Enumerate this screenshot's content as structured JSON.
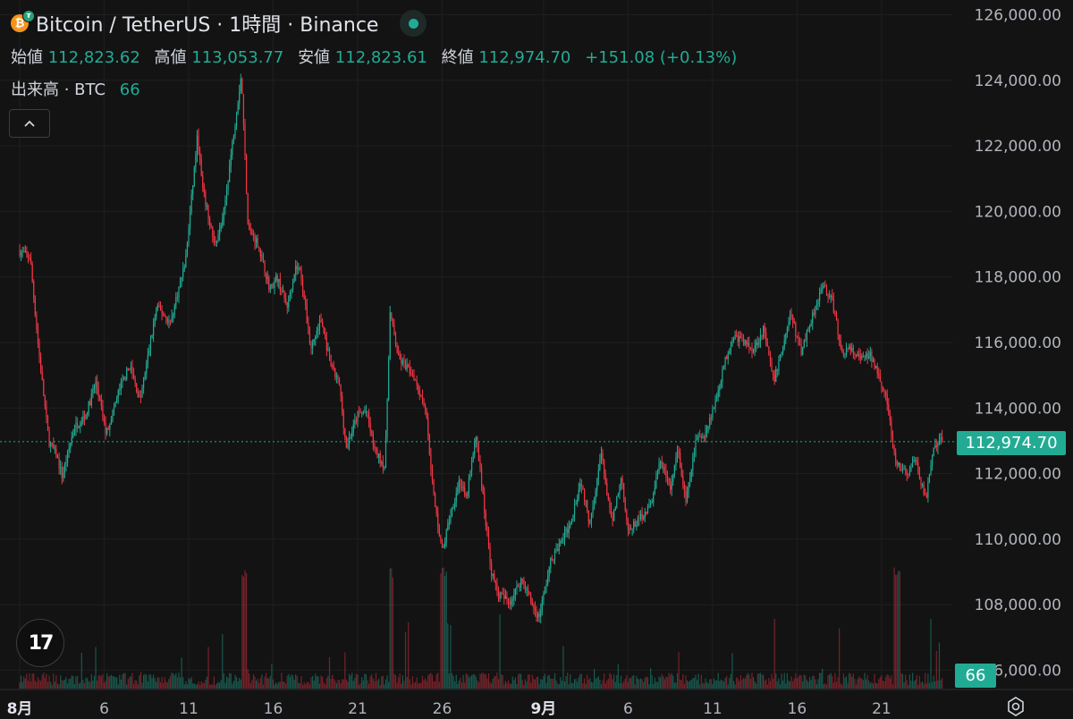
{
  "header": {
    "title": "Bitcoin / TetherUS · 1時間 · Binance",
    "ohlc": [
      {
        "label": "始値",
        "value": "112,823.62"
      },
      {
        "label": "高値",
        "value": "113,053.77"
      },
      {
        "label": "安値",
        "value": "112,823.61"
      },
      {
        "label": "終値",
        "value": "112,974.70"
      }
    ],
    "change": "+151.08 (+0.13%)",
    "volume_label": "出来高 · BTC",
    "volume_value": "66"
  },
  "price_tag": "112,974.70",
  "volume_tag": "66",
  "colors": {
    "up": "#22ab94",
    "down": "#f23645",
    "background": "#131313",
    "grid": "#1f1f1f"
  },
  "icons": {
    "logo": "tradingview-logo-icon",
    "coin": "bitcoin-icon",
    "settings": "settings-icon",
    "collapse": "chevron-up-icon"
  },
  "chart_data": {
    "type": "candlestick",
    "y_range": [
      106000,
      126500
    ],
    "y_ticks": [
      "126,000.00",
      "124,000.00",
      "122,000.00",
      "120,000.00",
      "118,000.00",
      "116,000.00",
      "114,000.00",
      "112,000.00",
      "110,000.00",
      "108,000.00",
      "106,000.00"
    ],
    "y_tick_values": [
      126000,
      124000,
      122000,
      120000,
      118000,
      116000,
      114000,
      112000,
      110000,
      108000,
      106000
    ],
    "x_ticks": [
      {
        "label": "8月",
        "day": 1,
        "bold": true
      },
      {
        "label": "6",
        "day": 6
      },
      {
        "label": "11",
        "day": 11
      },
      {
        "label": "16",
        "day": 16
      },
      {
        "label": "21",
        "day": 21
      },
      {
        "label": "26",
        "day": 26
      },
      {
        "label": "9月",
        "day": 32,
        "bold": true
      },
      {
        "label": "6",
        "day": 37
      },
      {
        "label": "11",
        "day": 42
      },
      {
        "label": "16",
        "day": 47
      },
      {
        "label": "21",
        "day": 52
      }
    ],
    "x_range_days": [
      1,
      56.5
    ],
    "last_price": 112974.7,
    "path": [
      [
        1.0,
        118800
      ],
      [
        1.7,
        118600
      ],
      [
        2.2,
        115800
      ],
      [
        2.8,
        113000
      ],
      [
        3.3,
        112500
      ],
      [
        3.6,
        111900
      ],
      [
        4.3,
        113400
      ],
      [
        5.0,
        113800
      ],
      [
        5.6,
        114800
      ],
      [
        6.2,
        113200
      ],
      [
        7.0,
        114600
      ],
      [
        7.6,
        115300
      ],
      [
        8.2,
        114200
      ],
      [
        9.2,
        117100
      ],
      [
        10.0,
        116600
      ],
      [
        10.9,
        118500
      ],
      [
        11.6,
        122300
      ],
      [
        11.9,
        120700
      ],
      [
        12.6,
        119000
      ],
      [
        13.1,
        119700
      ],
      [
        13.7,
        122200
      ],
      [
        14.2,
        124200
      ],
      [
        14.6,
        119500
      ],
      [
        15.2,
        119000
      ],
      [
        15.9,
        117600
      ],
      [
        16.3,
        118000
      ],
      [
        16.9,
        117100
      ],
      [
        17.4,
        118300
      ],
      [
        17.7,
        118200
      ],
      [
        18.3,
        115800
      ],
      [
        18.9,
        116700
      ],
      [
        19.5,
        115300
      ],
      [
        20.0,
        114700
      ],
      [
        20.4,
        112800
      ],
      [
        21.1,
        113800
      ],
      [
        21.6,
        113900
      ],
      [
        22.1,
        112700
      ],
      [
        22.7,
        112200
      ],
      [
        23.0,
        116900
      ],
      [
        23.5,
        115500
      ],
      [
        24.4,
        115000
      ],
      [
        25.1,
        114000
      ],
      [
        25.6,
        111200
      ],
      [
        26.1,
        109600
      ],
      [
        26.5,
        110600
      ],
      [
        27.1,
        111800
      ],
      [
        27.5,
        111200
      ],
      [
        28.1,
        113200
      ],
      [
        28.6,
        110800
      ],
      [
        29.0,
        109000
      ],
      [
        29.4,
        108300
      ],
      [
        30.1,
        108100
      ],
      [
        30.8,
        108800
      ],
      [
        31.5,
        107900
      ],
      [
        31.8,
        107600
      ],
      [
        32.5,
        109300
      ],
      [
        33.6,
        110400
      ],
      [
        34.3,
        111800
      ],
      [
        34.8,
        110500
      ],
      [
        35.5,
        112600
      ],
      [
        36.1,
        110500
      ],
      [
        36.7,
        111900
      ],
      [
        37.1,
        110200
      ],
      [
        37.7,
        110600
      ],
      [
        38.4,
        111000
      ],
      [
        39.0,
        112400
      ],
      [
        39.6,
        111500
      ],
      [
        40.0,
        112800
      ],
      [
        40.5,
        111100
      ],
      [
        41.1,
        113000
      ],
      [
        41.6,
        113200
      ],
      [
        42.2,
        114100
      ],
      [
        42.8,
        115400
      ],
      [
        43.3,
        116200
      ],
      [
        43.7,
        116100
      ],
      [
        44.5,
        115800
      ],
      [
        45.1,
        116400
      ],
      [
        45.7,
        114800
      ],
      [
        46.2,
        115800
      ],
      [
        46.7,
        116900
      ],
      [
        47.3,
        115700
      ],
      [
        48.1,
        117000
      ],
      [
        48.6,
        117800
      ],
      [
        49.2,
        117200
      ],
      [
        49.7,
        115700
      ],
      [
        50.2,
        115800
      ],
      [
        50.8,
        115500
      ],
      [
        51.4,
        115600
      ],
      [
        51.9,
        115100
      ],
      [
        52.4,
        114200
      ],
      [
        52.9,
        112300
      ],
      [
        53.6,
        112000
      ],
      [
        54.1,
        112400
      ],
      [
        54.7,
        111200
      ],
      [
        55.2,
        112800
      ],
      [
        55.6,
        113000
      ]
    ]
  }
}
